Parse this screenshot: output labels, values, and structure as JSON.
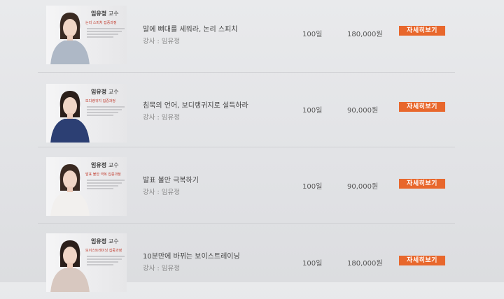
{
  "courses": [
    {
      "professor": "임유정",
      "professor_suffix": "교수",
      "course_tag": "논리 스피치 집중과정",
      "title": "말에 뼈대를 세워라, 논리 스피치",
      "teacher": "강사 : 임유정",
      "duration": "100일",
      "price": "180,000원",
      "button": "자세히보기",
      "outfit_color": "#aeb8c6"
    },
    {
      "professor": "임유정",
      "professor_suffix": "교수",
      "course_tag": "보디랭귀지 집중과정",
      "title": "침묵의 언어, 보디랭귀지로 설득하라",
      "teacher": "강사 : 임유정",
      "duration": "100일",
      "price": "90,000원",
      "button": "자세히보기",
      "outfit_color": "#2c3f73"
    },
    {
      "professor": "임유정",
      "professor_suffix": "교수",
      "course_tag": "발표 불안 극복 집중과정",
      "title": "발표 불안 극복하기",
      "teacher": "강사 : 임유정",
      "duration": "100일",
      "price": "90,000원",
      "button": "자세히보기",
      "outfit_color": "#f2f0ee"
    },
    {
      "professor": "임유정",
      "professor_suffix": "교수",
      "course_tag": "보이스트레이닝 집중과정",
      "title": "10분만에 바뀌는 보이스트레이닝",
      "teacher": "강사 : 임유정",
      "duration": "100일",
      "price": "180,000원",
      "button": "자세히보기",
      "outfit_color": "#d8c8c0"
    }
  ],
  "colors": {
    "accent": "#e8672c",
    "tag": "#c0392b"
  }
}
